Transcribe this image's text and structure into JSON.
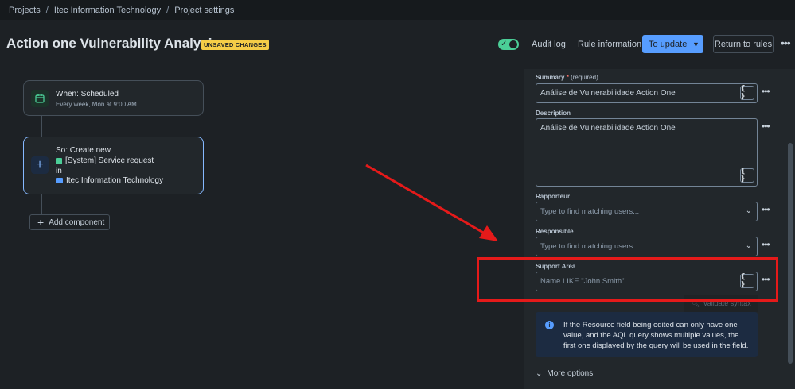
{
  "breadcrumb": {
    "items": [
      "Projects",
      "Itec Information Technology",
      "Project settings"
    ],
    "separator": "/"
  },
  "header": {
    "title": "Action one Vulnerability Analysis",
    "badge": "UNSAVED CHANGES",
    "toggle_on": true,
    "audit_log": "Audit log",
    "rule_information": "Rule information",
    "update_button": "To update",
    "return_button": "Return to rules"
  },
  "flow": {
    "trigger": {
      "title": "When: Scheduled",
      "subtitle": "Every week, Mon at 9:00 AM",
      "icon": "calendar-icon"
    },
    "action": {
      "title": "So: Create new",
      "issue_type": "[System] Service request",
      "in_label": "in",
      "project": "Itec Information Technology",
      "icon": "plus-icon"
    },
    "add_component": "Add component"
  },
  "form": {
    "summary": {
      "label": "Summary",
      "required_mark": "*",
      "required_text": "(required)",
      "value": "Análise de Vulnerabilidade Action One"
    },
    "description": {
      "label": "Description",
      "value": "Análise de Vulnerabilidade Action One"
    },
    "rapporteur": {
      "label": "Rapporteur",
      "placeholder": "Type to find matching users..."
    },
    "responsible": {
      "label": "Responsible",
      "placeholder": "Type to find matching users..."
    },
    "support_area": {
      "label": "Support Area",
      "placeholder": "Name LIKE \"John Smith\""
    },
    "validate_syntax": "Validate syntax",
    "info_text": "If the Resource field being edited can only have one value, and the AQL query shows multiple values, the first one displayed by the query will be used in the field.",
    "more_options": "More options",
    "smart_value_glyph": "{ }"
  },
  "colors": {
    "background": "#1d2125",
    "accent": "#579dff",
    "badge": "#f5cd47",
    "toggle": "#4bce97",
    "annotation": "#e51a1a"
  }
}
